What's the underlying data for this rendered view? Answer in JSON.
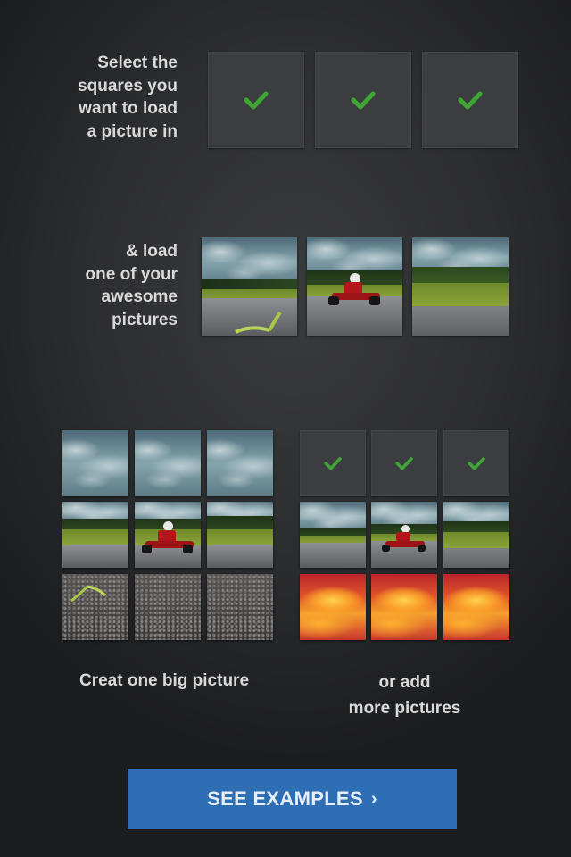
{
  "intro": {
    "select_text": [
      "Select the",
      "squares you",
      "want to load",
      "a picture in"
    ],
    "load_text": [
      "& load",
      "one of your",
      "awesome",
      "pictures"
    ]
  },
  "bottom": {
    "left_caption": "Creat one big picture",
    "right_caption": [
      "or add",
      "more pictures"
    ]
  },
  "cta": {
    "label": "SEE EXAMPLES",
    "chevron": "›"
  },
  "colors": {
    "background": "#2c2d2f",
    "square": "#3c3d40",
    "check": "#3fa535",
    "button": "#2e6eb4",
    "text": "#d9d9d9"
  },
  "icons": [
    "check-icon",
    "chevron-right-icon"
  ]
}
